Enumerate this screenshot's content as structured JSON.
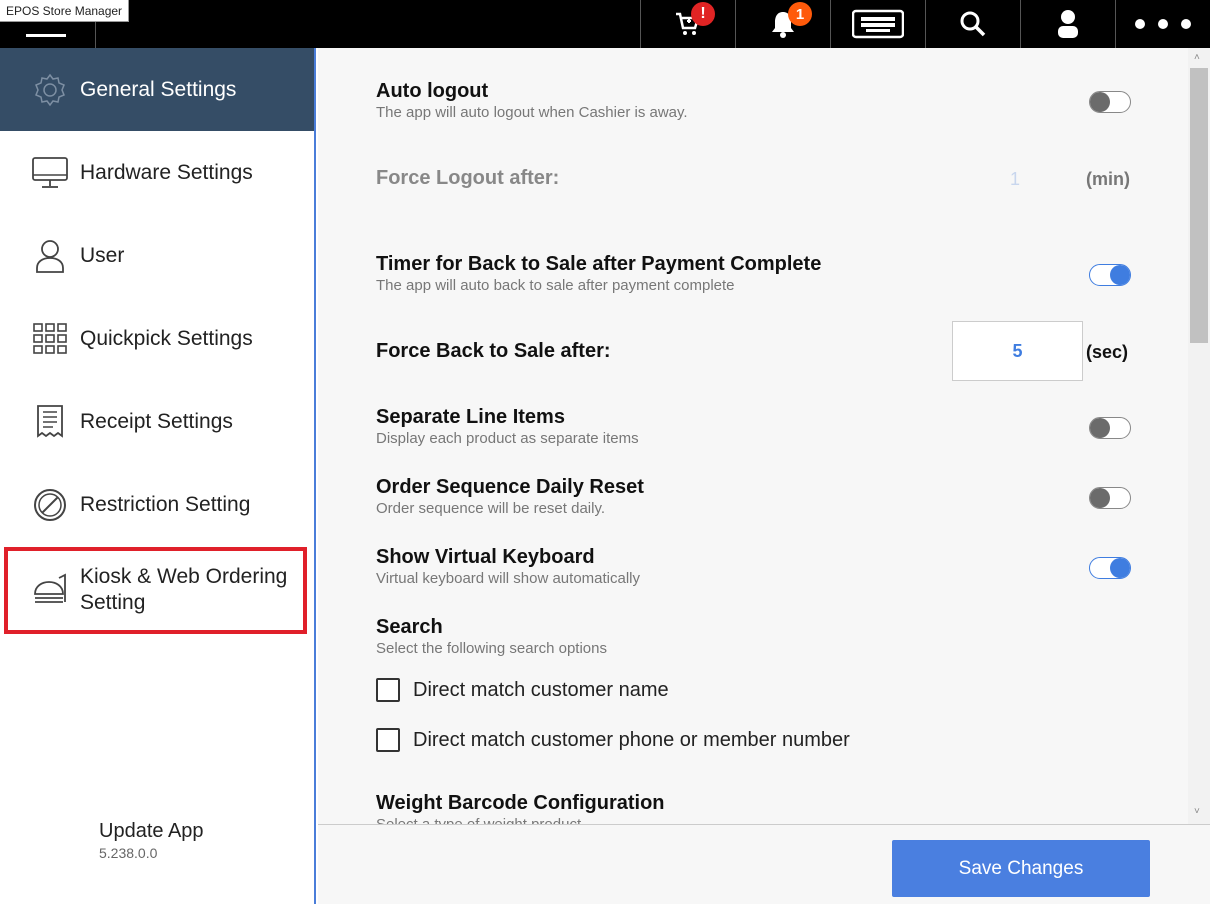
{
  "app": {
    "title": "EPOS Store Manager"
  },
  "topbar": {
    "icons": [
      "cart-icon",
      "bell-icon",
      "keyboard-icon",
      "search-icon",
      "user-icon",
      "more-icon"
    ],
    "cart_badge": "!",
    "bell_badge": "1"
  },
  "sidebar": {
    "items": [
      {
        "label": "General Settings",
        "icon": "gear-icon",
        "active": true
      },
      {
        "label": "Hardware Settings",
        "icon": "monitor-icon"
      },
      {
        "label": "User",
        "icon": "user-outline-icon"
      },
      {
        "label": "Quickpick Settings",
        "icon": "grid-icon"
      },
      {
        "label": "Receipt Settings",
        "icon": "receipt-icon"
      },
      {
        "label": "Restriction Setting",
        "icon": "restriction-icon"
      },
      {
        "label_line1": "Kiosk & Web Ordering",
        "label_line2": "Setting",
        "icon": "kiosk-icon"
      }
    ],
    "update": {
      "title": "Update App",
      "version": "5.238.0.0"
    }
  },
  "settings": {
    "auto_logout": {
      "title": "Auto logout",
      "desc": "The app will auto logout when Cashier is away.",
      "enabled": false
    },
    "force_logout": {
      "title": "Force Logout after:",
      "value": "1",
      "unit": "(min)"
    },
    "timer_back": {
      "title": "Timer for Back to Sale after Payment Complete",
      "desc": "The app will auto back to sale after payment complete",
      "enabled": true
    },
    "force_back": {
      "title": "Force Back to Sale after:",
      "value": "5",
      "unit": "(sec)"
    },
    "separate_lines": {
      "title": "Separate Line Items",
      "desc": "Display each product as separate items",
      "enabled": false
    },
    "order_reset": {
      "title": "Order Sequence Daily Reset",
      "desc": "Order sequence will be reset daily.",
      "enabled": false
    },
    "virtual_keyboard": {
      "title": "Show Virtual Keyboard",
      "desc": "Virtual keyboard will show automatically",
      "enabled": true
    },
    "search": {
      "title": "Search",
      "desc": "Select the following search options",
      "options": [
        "Direct match customer name",
        "Direct match customer phone or member number"
      ]
    },
    "weight_barcode": {
      "title": "Weight Barcode Configuration",
      "desc": "Select a type of weight product"
    }
  },
  "footer": {
    "save_label": "Save Changes"
  },
  "colors": {
    "accent": "#4a7fe0",
    "sidebar_active": "#354d66",
    "highlight": "#e0202a",
    "topbar": "#000000"
  }
}
